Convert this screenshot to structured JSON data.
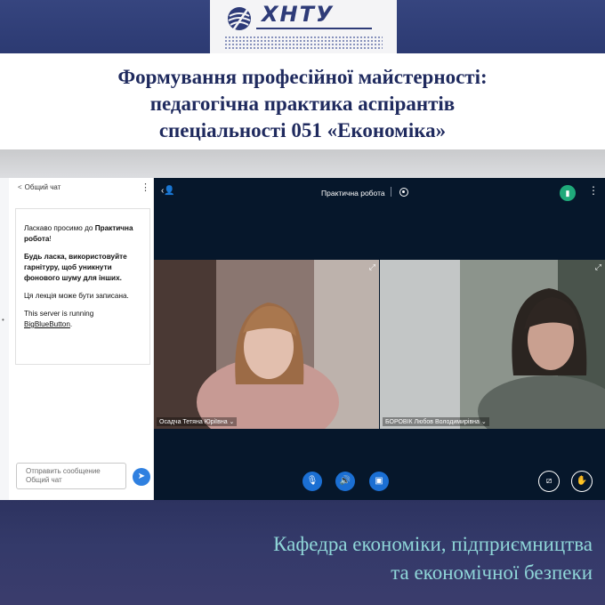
{
  "logo": {
    "text": "ХНТУ"
  },
  "title": {
    "line1": "Формування професійної майстерності:",
    "line2": "педагогічна практика аспірантів",
    "line3": "спеціальності 051 «Економіка»"
  },
  "chat": {
    "back_icon": "chevron-left-icon",
    "header": "Общий чат",
    "welcome_prefix": "Ласкаво просимо до ",
    "welcome_room": "Практична робота",
    "welcome_suffix": "!",
    "headset_notice": "Будь ласка, використовуйте гарнітуру, щоб уникнути фонового шуму для інших.",
    "recording_notice": "Ця лекція може бути записана.",
    "server_prefix": "This server is running ",
    "server_link": "BigBlueButton",
    "server_suffix": ".",
    "input_placeholder": "Отправить сообщение Общий чат",
    "send_icon": "send-icon"
  },
  "conference": {
    "room_title": "Практична робота",
    "users_icon": "users-icon",
    "record_icon": "record-icon",
    "connection_icon": "signal-bars-icon",
    "participants": [
      {
        "name": "Осадча Тетяна Юріївна ⌄"
      },
      {
        "name": "БОРОВІК Любов Володимирівна ⌄"
      }
    ],
    "controls": {
      "mic_icon": "microphone-icon",
      "audio_icon": "speaker-icon",
      "camera_icon": "camera-icon",
      "screen_share_icon": "screen-share-off-icon",
      "raise_hand_icon": "raise-hand-icon"
    },
    "colors": {
      "background": "#06172b",
      "accent": "#1b6fd3",
      "connection": "#1fa97a"
    }
  },
  "department": {
    "line1": "Кафедра економіки, підприємництва",
    "line2": "та економічної безпеки"
  }
}
